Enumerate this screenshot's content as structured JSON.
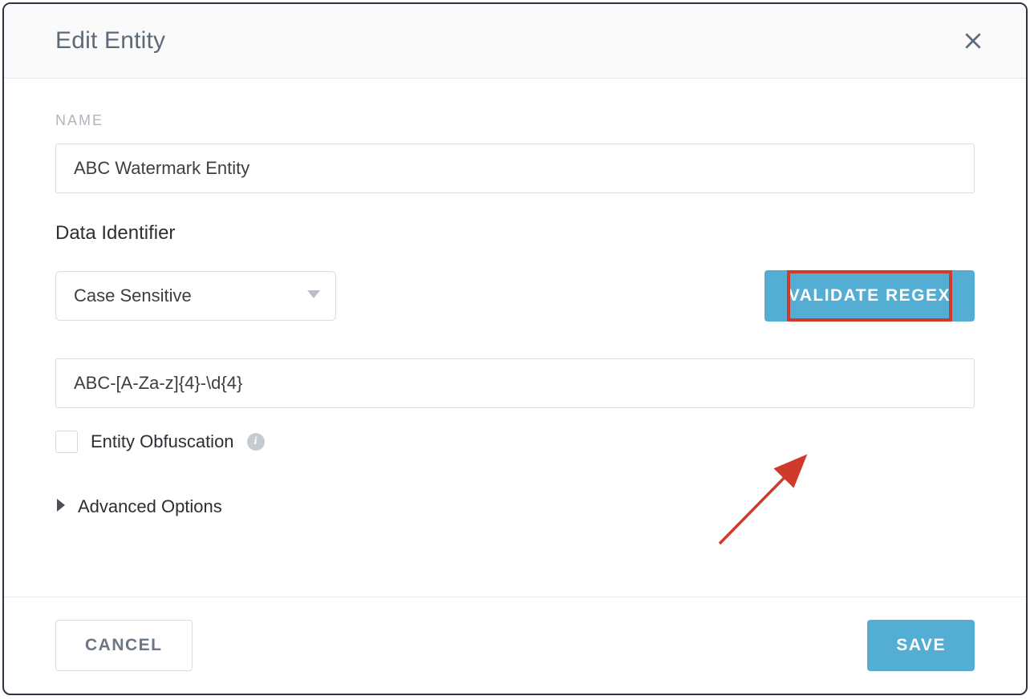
{
  "modal": {
    "title": "Edit Entity"
  },
  "form": {
    "name_label": "NAME",
    "name_value": "ABC Watermark Entity",
    "data_identifier_heading": "Data Identifier",
    "case_mode_selected": "Case Sensitive",
    "validate_button": "VALIDATE REGEX",
    "regex_value": "ABC-[A-Za-z]{4}-\\d{4}",
    "obfuscation_label": "Entity Obfuscation",
    "obfuscation_checked": false,
    "advanced_label": "Advanced Options"
  },
  "footer": {
    "cancel": "CANCEL",
    "save": "SAVE"
  },
  "colors": {
    "accent": "#54aed3",
    "highlight": "#cf3a2b"
  }
}
